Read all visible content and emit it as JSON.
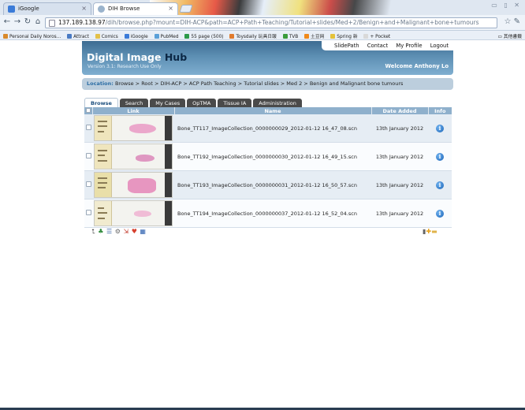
{
  "browser": {
    "tabs": [
      {
        "label": "iGoogle",
        "favicon_color": "#3b7bd8"
      },
      {
        "label": "DIH Browse",
        "favicon_color": "#9ab3cc"
      }
    ],
    "window_controls": "▭ ▯ ✕",
    "address": {
      "host": "137.189.138.97",
      "path": "/dih/browse.php?mount=DIH-ACP&path=ACP+Path+Teaching/Tutorial+slides/Med+2/Benign+and+Malignant+bone+tumours"
    },
    "bookmarks": [
      {
        "label": "Personal Daily Noros...",
        "color": "#d98a2b"
      },
      {
        "label": "Attract",
        "color": "#4a7bc4"
      },
      {
        "label": "Comics",
        "color": "#e3c14a"
      },
      {
        "label": "iGoogle",
        "color": "#3b7bd8"
      },
      {
        "label": "PubMed",
        "color": "#5aa0d8"
      },
      {
        "label": "55 page (500)",
        "color": "#2d9a4a"
      },
      {
        "label": "Toysdaily 玩具日報",
        "color": "#e07b2e"
      },
      {
        "label": "TVB",
        "color": "#3b9c3b"
      },
      {
        "label": "土豆网",
        "color": "#f08a1c"
      },
      {
        "label": "Spring 新",
        "color": "#e4c23a"
      },
      {
        "label": "+ Pocket",
        "color": "#d9d9d9"
      }
    ],
    "other_bookmarks": "其他書籤"
  },
  "header": {
    "nav": [
      "SlidePath",
      "Contact",
      "My Profile",
      "Logout"
    ],
    "brand_main": "Digital Image ",
    "brand_hub": "Hub",
    "version": "Version 3.1: Research Use Only",
    "welcome": "Welcome Anthony Lo"
  },
  "location": {
    "label": "Location:",
    "path": "Browse > Root > DIH-ACP > ACP Path Teaching > Tutorial slides > Med 2 > Benign and Malignant bone tumours"
  },
  "tabs": [
    "Browse",
    "Search",
    "My Cases",
    "OpTMA",
    "Tissue IA",
    "Administration"
  ],
  "table": {
    "headers": [
      "",
      "Link",
      "Name",
      "Date Added",
      "Info"
    ],
    "rows": [
      {
        "name": "Bone_TT117_ImageCollection_0000000029_2012-01-12 16_47_08.scn",
        "date": "13th January 2012"
      },
      {
        "name": "Bone_TT192_ImageCollection_0000000030_2012-01-12 16_49_15.scn",
        "date": "13th January 2012"
      },
      {
        "name": "Bone_TT193_ImageCollection_0000000031_2012-01-12 16_50_57.scn",
        "date": "13th January 2012"
      },
      {
        "name": "Bone_TT194_ImageCollection_0000000037_2012-01-12 16_52_04.scn",
        "date": "13th January 2012"
      }
    ]
  },
  "footer_icons": [
    "up-arrow-icon",
    "tree-icon",
    "list-icon",
    "gear-icon",
    "export-icon",
    "bookmark-icon",
    "calendar-icon"
  ],
  "footer_right_icons": [
    "trash-icon",
    "add-icon"
  ]
}
